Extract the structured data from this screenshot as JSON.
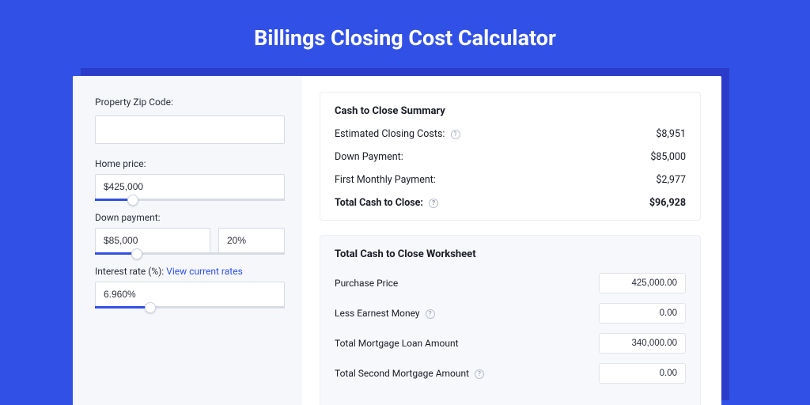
{
  "page_title": "Billings Closing Cost Calculator",
  "inputs": {
    "zip_label": "Property Zip Code:",
    "zip_value": "",
    "home_price_label": "Home price:",
    "home_price_value": "$425,000",
    "home_price_pct": 20,
    "down_payment_label": "Down payment:",
    "down_payment_value": "$85,000",
    "down_payment_pct_value": "20%",
    "down_payment_slider_pct": 22,
    "interest_label_prefix": "Interest rate (%): ",
    "interest_link_text": "View current rates",
    "interest_value": "6.960%",
    "interest_slider_pct": 29
  },
  "summary": {
    "title": "Cash to Close Summary",
    "rows": [
      {
        "label": "Estimated Closing Costs:",
        "help": true,
        "value": "$8,951"
      },
      {
        "label": "Down Payment:",
        "help": false,
        "value": "$85,000"
      },
      {
        "label": "First Monthly Payment:",
        "help": false,
        "value": "$2,977"
      }
    ],
    "total": {
      "label": "Total Cash to Close:",
      "help": true,
      "value": "$96,928"
    }
  },
  "worksheet": {
    "title": "Total Cash to Close Worksheet",
    "rows": [
      {
        "label": "Purchase Price",
        "help": false,
        "value": "425,000.00"
      },
      {
        "label": "Less Earnest Money",
        "help": true,
        "value": "0.00"
      },
      {
        "label": "Total Mortgage Loan Amount",
        "help": false,
        "value": "340,000.00"
      },
      {
        "label": "Total Second Mortgage Amount",
        "help": true,
        "value": "0.00"
      }
    ]
  }
}
